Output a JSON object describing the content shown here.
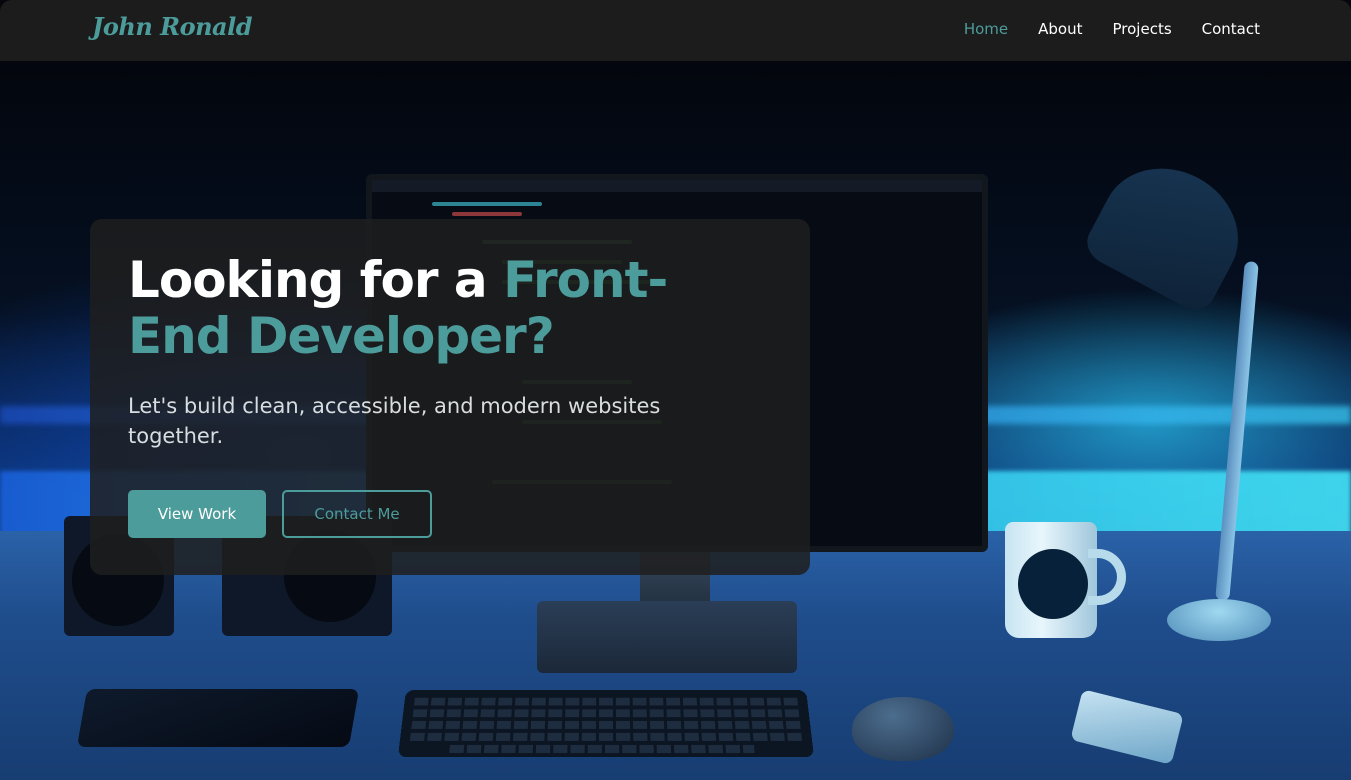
{
  "nav": {
    "logo": "John Ronald",
    "links": [
      {
        "label": "Home",
        "active": true
      },
      {
        "label": "About",
        "active": false
      },
      {
        "label": "Projects",
        "active": false
      },
      {
        "label": "Contact",
        "active": false
      }
    ]
  },
  "hero": {
    "title_plain": "Looking for a ",
    "title_accent": "Front-End Developer?",
    "subtitle": "Let's build clean, accessible, and modern websites together.",
    "primary_button": "View Work",
    "secondary_button": "Contact Me"
  },
  "background": {
    "description_icon": "desk-setup-illustration"
  },
  "colors": {
    "accent": "#4c9c9b",
    "navbar": "#1c1c1c",
    "card": "#1e1e1e",
    "text": "#ffffff"
  }
}
